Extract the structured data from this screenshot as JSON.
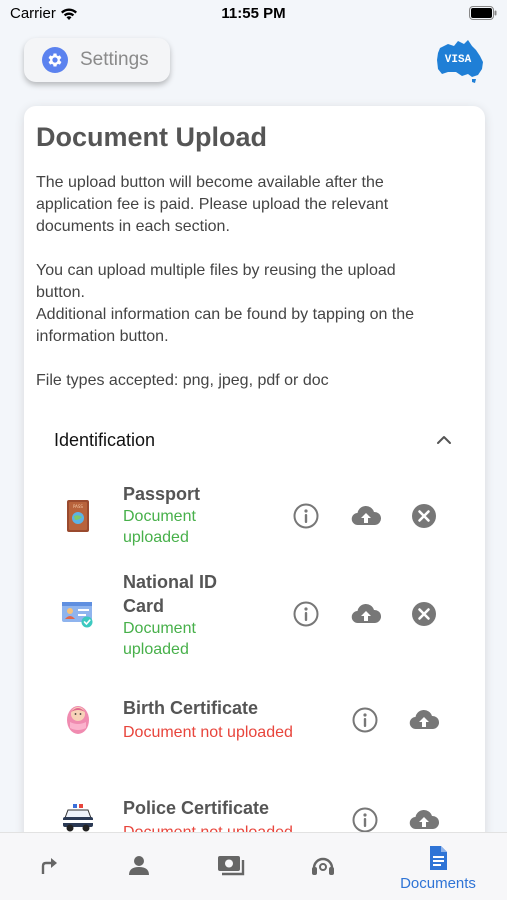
{
  "status_bar": {
    "carrier": "Carrier",
    "time": "11:55 PM"
  },
  "header": {
    "settings_label": "Settings",
    "logo_text": "VISA"
  },
  "card": {
    "title": "Document Upload",
    "paragraph1": [
      "The upload button will become available after the",
      "application fee is paid. Please upload the relevant",
      "documents in each section."
    ],
    "paragraph2": [
      "You can upload multiple files by reusing the upload",
      "button.",
      "Additional information can be found by tapping on the",
      "information button."
    ],
    "file_types": "File types accepted: png, jpeg, pdf or doc",
    "section": {
      "title": "Identification",
      "expanded": true
    },
    "documents": [
      {
        "name_lines": [
          "Passport"
        ],
        "status_lines": [
          "Document",
          "uploaded"
        ],
        "uploaded": true,
        "icon": "passport-icon"
      },
      {
        "name_lines": [
          "National ID",
          "Card"
        ],
        "status_lines": [
          "Document",
          "uploaded"
        ],
        "uploaded": true,
        "icon": "id-card-icon"
      },
      {
        "name_lines": [
          "Birth Certificate"
        ],
        "status_lines": [
          "Document not uploaded"
        ],
        "uploaded": false,
        "icon": "baby-icon"
      },
      {
        "name_lines": [
          "Police Certificate"
        ],
        "status_lines": [
          "Document not uploaded"
        ],
        "uploaded": false,
        "icon": "police-car-icon"
      }
    ]
  },
  "tabbar": {
    "active_label": "Documents"
  },
  "colors": {
    "accent": "#2f74d6",
    "uploaded": "#47b04a",
    "not_uploaded": "#e8453c",
    "gear": "#5b82ef"
  }
}
